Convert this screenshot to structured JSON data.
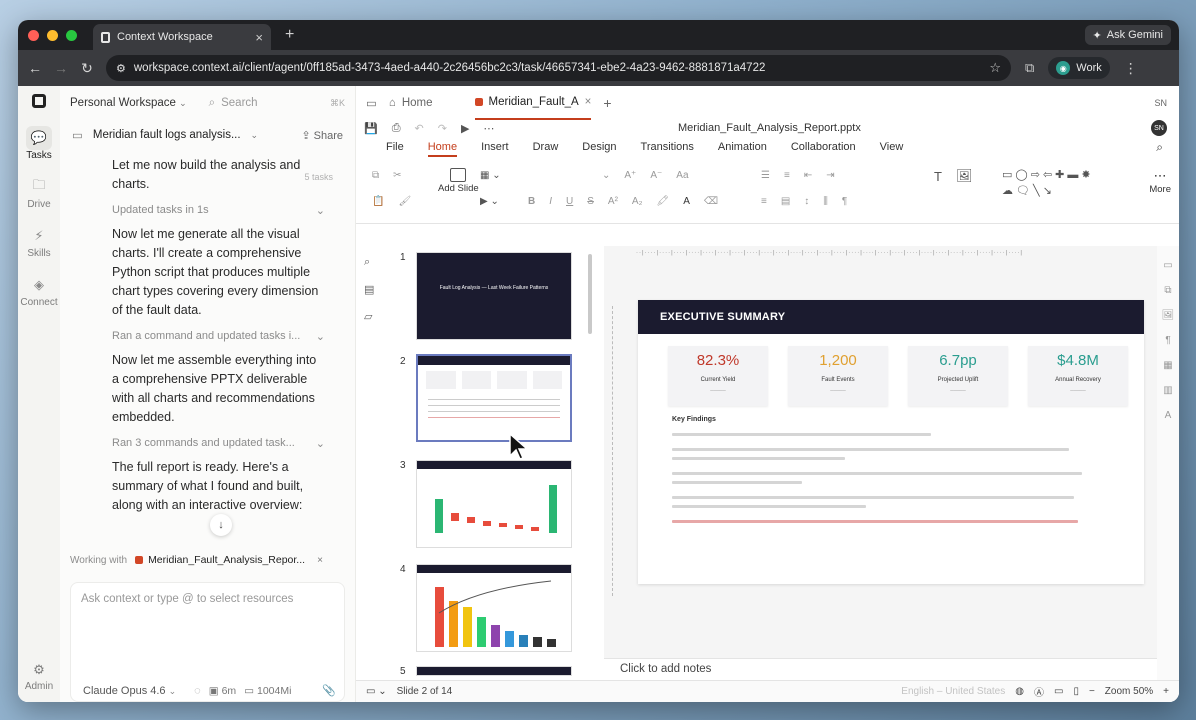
{
  "browser": {
    "tab_title": "Context Workspace",
    "gemini_label": "Ask Gemini",
    "url": "workspace.context.ai/client/agent/0ff185ad-3473-4aed-a440-2c26456bc2c3/task/46657341-ebe2-4a23-9462-8881871a4722",
    "profile_label": "Work",
    "traffic_colors": [
      "#ff5f57",
      "#febc2e",
      "#28c840"
    ]
  },
  "rail": {
    "items": [
      {
        "label": "Tasks"
      },
      {
        "label": "Drive"
      },
      {
        "label": "Skills"
      },
      {
        "label": "Connect"
      }
    ],
    "bottom_label": "Admin"
  },
  "chat": {
    "workspace": "Personal Workspace",
    "search_placeholder": "Search",
    "search_shortcut": "⌘K",
    "task_title": "Meridian fault logs analysis...",
    "share_label": "Share",
    "subtask_count": "5 tasks",
    "messages": [
      {
        "type": "msg",
        "text": "Let me now build the analysis and charts."
      },
      {
        "type": "meta",
        "text": "Updated tasks in 1s"
      },
      {
        "type": "msg",
        "text": "Now let me generate all the visual charts. I'll create a comprehensive Python script that produces multiple chart types covering every dimension of the fault data."
      },
      {
        "type": "meta",
        "text": "Ran a command and updated tasks i..."
      },
      {
        "type": "msg",
        "text": "Now let me assemble everything into a comprehensive PPTX deliverable with all charts and recommendations embedded."
      },
      {
        "type": "meta",
        "text": "Ran 3 commands and updated task..."
      },
      {
        "type": "msg",
        "text": "The full report is ready. Here's a summary of what I found and built, along with an interactive overview:"
      }
    ],
    "working_with_label": "Working with",
    "working_file": "Meridian_Fault_Analysis_Repor...",
    "composer_placeholder": "Ask context or type @ to select resources",
    "model": "Claude Opus 4.6",
    "time_stat": "6m",
    "memory_stat": "1004Mi"
  },
  "editor": {
    "tabs": [
      {
        "label": "Home"
      },
      {
        "label": "Meridian_Fault_A"
      }
    ],
    "user_initials": "SN",
    "doc_title": "Meridian_Fault_Analysis_Report.pptx",
    "menu": [
      "File",
      "Home",
      "Insert",
      "Draw",
      "Design",
      "Transitions",
      "Animation",
      "Collaboration",
      "View"
    ],
    "active_menu": "Home",
    "add_slide_label": "Add Slide",
    "more_label": "More",
    "thumb1_title": "Fault Log Analysis — Last Week Failure Patterns",
    "slide": {
      "header": "EXECUTIVE SUMMARY",
      "kpis": [
        {
          "value": "82.3%",
          "label": "Current Yield",
          "color": "#c0392b"
        },
        {
          "value": "1,200",
          "label": "Fault Events",
          "color": "#e0a030"
        },
        {
          "value": "6.7pp",
          "label": "Projected Uplift",
          "color": "#2a9d8f"
        },
        {
          "value": "$4.8M",
          "label": "Annual Recovery",
          "color": "#2a9d8f"
        }
      ],
      "findings_heading": "Key Findings"
    },
    "notes_placeholder": "Click to add notes",
    "status": {
      "slide_info": "Slide 2 of 14",
      "language": "English – United States",
      "zoom": "Zoom 50%"
    }
  }
}
